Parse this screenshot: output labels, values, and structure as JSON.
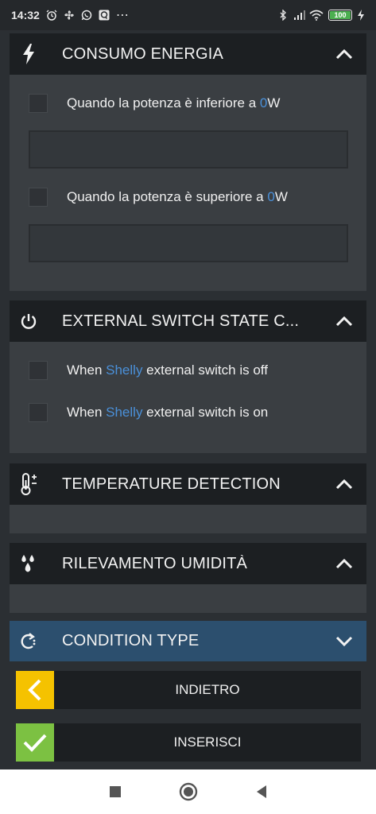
{
  "status_bar": {
    "time": "14:32",
    "more": "⋯",
    "battery": "100",
    "left_icons": [
      "alarm-icon",
      "fan-icon",
      "whatsapp-icon",
      "q-app-icon"
    ],
    "right_icons": [
      "bluetooth-icon",
      "signal-icon",
      "wifi-icon",
      "battery-icon",
      "charging-icon"
    ]
  },
  "sections": {
    "energy": {
      "title": "CONSUMO ENERGIA",
      "icon": "lightning-icon",
      "expanded": true,
      "options": [
        {
          "prefix": "Quando la potenza è inferiore a ",
          "value": "0",
          "suffix": "W",
          "checked": false,
          "input_value": ""
        },
        {
          "prefix": "Quando la potenza è superiore a ",
          "value": "0",
          "suffix": "W",
          "checked": false,
          "input_value": ""
        }
      ]
    },
    "external_switch": {
      "title": "EXTERNAL SWITCH STATE C...",
      "icon": "power-icon",
      "expanded": true,
      "options": [
        {
          "prefix": "When ",
          "brand": "Shelly",
          "suffix": " external switch is off",
          "checked": false
        },
        {
          "prefix": "When ",
          "brand": "Shelly",
          "suffix": " external switch is on",
          "checked": false
        }
      ]
    },
    "temperature": {
      "title": "TEMPERATURE DETECTION",
      "icon": "thermometer-icon",
      "expanded": true
    },
    "humidity": {
      "title": "RILEVAMENTO UMIDITÀ",
      "icon": "humidity-drops-icon",
      "expanded": true
    },
    "condition_type": {
      "title": "CONDITION TYPE",
      "icon": "condition-cycle-icon",
      "expanded": false
    }
  },
  "buttons": {
    "back": {
      "label": "INDIETRO",
      "icon": "chevron-left-icon",
      "color": "#f5c200"
    },
    "insert": {
      "label": "INSERISCI",
      "icon": "checkmark-icon",
      "color": "#7cc142"
    }
  },
  "nav_bar": {
    "icons": [
      "recents-square-icon",
      "home-circle-icon",
      "back-triangle-icon"
    ]
  },
  "colors": {
    "accent": "#4a90d9",
    "header_bg": "#1c1f22",
    "body_bg": "#3a3e42",
    "condition_header_bg": "#2c4f6e"
  }
}
